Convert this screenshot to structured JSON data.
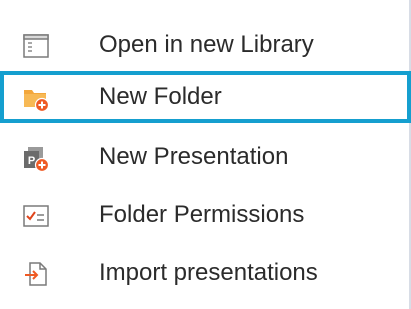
{
  "menu": {
    "items": [
      {
        "label": "Open in new Library",
        "icon": "library-window-icon",
        "selected": false
      },
      {
        "label": "New Folder",
        "icon": "new-folder-icon",
        "selected": true
      },
      {
        "label": "New Presentation",
        "icon": "new-presentation-icon",
        "selected": false
      },
      {
        "label": "Folder Permissions",
        "icon": "permissions-checklist-icon",
        "selected": false
      },
      {
        "label": "Import presentations",
        "icon": "import-icon",
        "selected": false
      }
    ]
  },
  "colors": {
    "highlight_border": "#159fcf",
    "folder": "#f3a73b",
    "badge": "#ef5a24",
    "presentation": "#6b6b6b"
  }
}
